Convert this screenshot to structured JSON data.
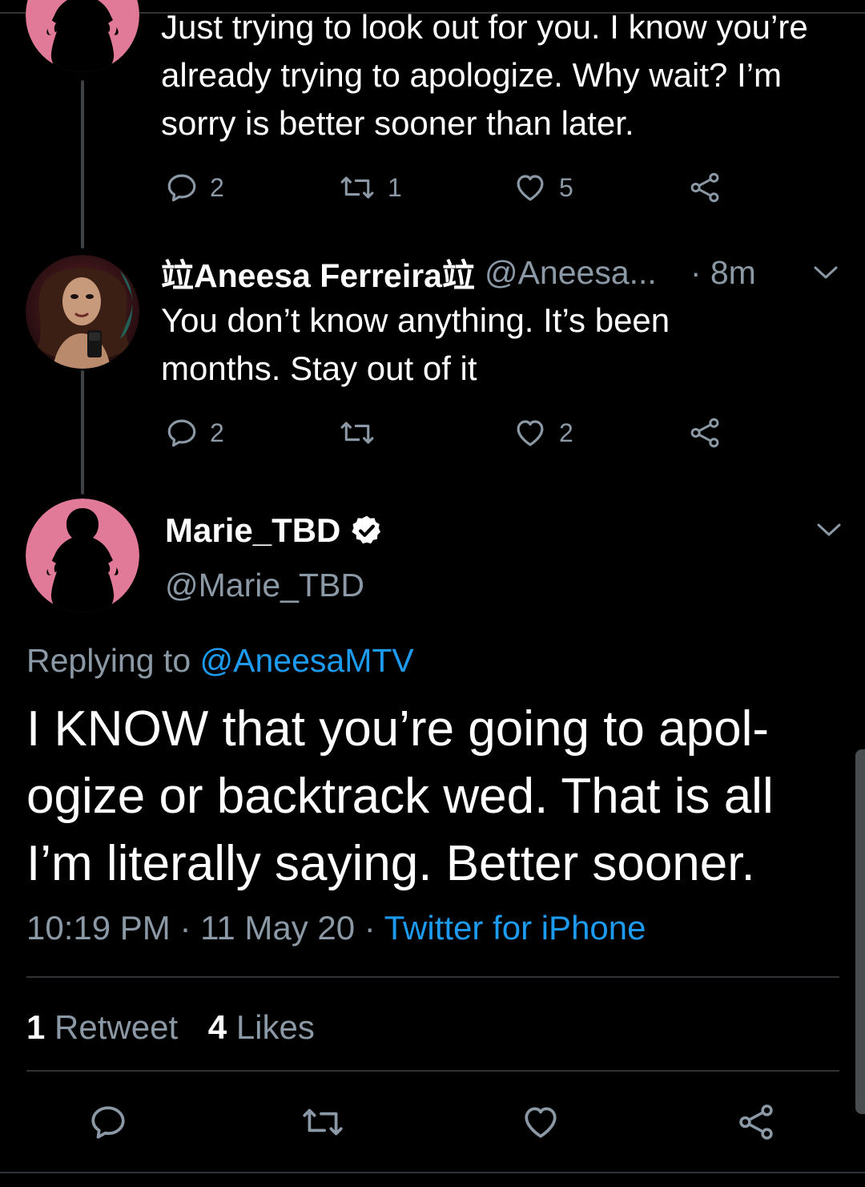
{
  "colors": {
    "background": "#000000",
    "text": "#ffffff",
    "muted": "#8b98a5",
    "link": "#1d9bf0",
    "avatar_pink": "#e07a98"
  },
  "tweet1": {
    "avatar_icon": "woman-silhouette-avatar",
    "text": "Just trying to look out for you. I know you’re already trying to apologize. Why wait? I’m sorry is better sooner than later.",
    "replies": "2",
    "retweets": "1",
    "likes": "5"
  },
  "tweet2": {
    "avatar_icon": "selfie-photo-avatar",
    "name": "🛈Aneesa Ferreira🛈",
    "name_display": "竝Aneesa Ferreira竝",
    "handle": "@Aneesa...",
    "time": "· 8m",
    "text": "You don’t know anything. It’s been months. Stay out of it",
    "replies": "2",
    "retweets": "",
    "likes": "2"
  },
  "main_tweet": {
    "avatar_icon": "woman-silhouette-avatar",
    "name": "Marie_TBD",
    "handle": "@Marie_TBD",
    "replying_prefix": "Replying to",
    "replying_handle": "@AneesaMTV",
    "text": "I KNOW that you’re going to apol- ogize or backtrack wed. That is all I’m literally saying. Better sooner.",
    "time": "10:19 PM",
    "date": "11 May 20",
    "source": "Twitter for iPhone",
    "retweet_count": "1",
    "retweet_label": "Retweet",
    "like_count": "4",
    "like_label": "Likes"
  }
}
